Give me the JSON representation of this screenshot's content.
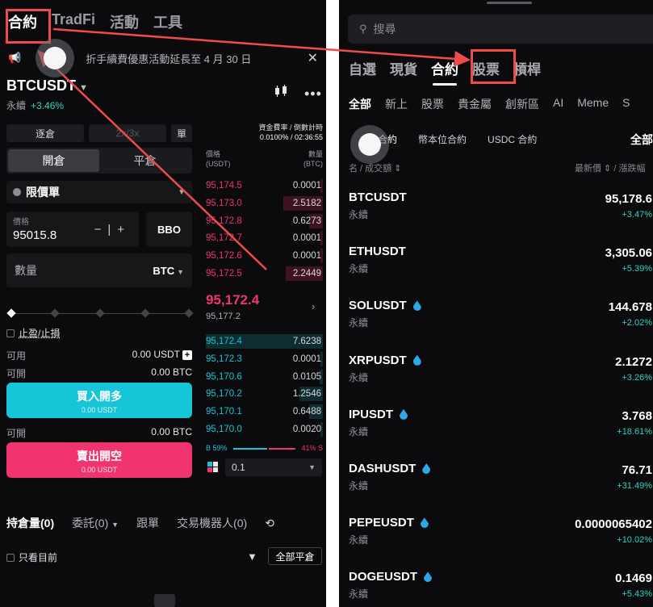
{
  "left": {
    "top_tabs": [
      "合約",
      "TradFi",
      "活動",
      "工具"
    ],
    "notice_text": "折手續費優惠活動延長至 4 月 30 日",
    "pair": {
      "symbol": "BTCUSDT",
      "type": "永續",
      "change": "+3.46%"
    },
    "margin_modes": [
      "逐倉",
      "2x/3x",
      "單"
    ],
    "open_close": [
      "開倉",
      "平倉"
    ],
    "order_type": "限價單",
    "price": {
      "label": "價格",
      "value": "95015.8",
      "minus": "−",
      "plus": "+"
    },
    "bbo_label": "BBO",
    "quantity": {
      "placeholder": "數量",
      "unit": "BTC"
    },
    "tpsl_label": "止盈/止損",
    "available": {
      "label": "可用",
      "value": "0.00 USDT"
    },
    "can_open_long": {
      "label": "可開",
      "value": "0.00 BTC"
    },
    "buy": {
      "label": "買入開多",
      "sub": "0.00 USDT"
    },
    "can_open_short": {
      "label": "可開",
      "value": "0.00 BTC"
    },
    "sell": {
      "label": "賣出開空",
      "sub": "0.00 USDT"
    },
    "funding": {
      "title": "資金費率 / 倒數計時",
      "value": "0.0100% / 02:36:55"
    },
    "orderbook_cols": {
      "price": "價格\n(USDT)",
      "amount": "數量\n(BTC)"
    },
    "asks": [
      {
        "price": "95,174.5",
        "amount": "0.0001",
        "depth": 0.02
      },
      {
        "price": "95,173.0",
        "amount": "2.5182",
        "depth": 0.34
      },
      {
        "price": "95,172.8",
        "amount": "0.6273",
        "depth": 0.12
      },
      {
        "price": "95,172.7",
        "amount": "0.0001",
        "depth": 0.02
      },
      {
        "price": "95,172.6",
        "amount": "0.0001",
        "depth": 0.02
      },
      {
        "price": "95,172.5",
        "amount": "2.2449",
        "depth": 0.32
      }
    ],
    "last_price": "95,172.4",
    "mark_price": "95,177.2",
    "bids": [
      {
        "price": "95,172.4",
        "amount": "7.6238",
        "depth": 1.0
      },
      {
        "price": "95,172.3",
        "amount": "0.0001",
        "depth": 0.02
      },
      {
        "price": "95,170.6",
        "amount": "0.0105",
        "depth": 0.03
      },
      {
        "price": "95,170.2",
        "amount": "1.2546",
        "depth": 0.2
      },
      {
        "price": "95,170.1",
        "amount": "0.6488",
        "depth": 0.12
      },
      {
        "price": "95,170.0",
        "amount": "0.0020",
        "depth": 0.02
      }
    ],
    "ratio": {
      "buy": "B 59%",
      "sell": "41% S"
    },
    "depth_value": "0.1",
    "bottom_tabs": [
      "持倉量(0)",
      "委託(0)",
      "跟單",
      "交易機器人(0)"
    ],
    "only_current": "只看目前",
    "close_all": "全部平倉"
  },
  "right": {
    "search_placeholder": "搜尋",
    "tabs": [
      "自選",
      "現貨",
      "合約",
      "股票",
      "槓桿"
    ],
    "categories": [
      "全部",
      "新上",
      "股票",
      "貴金屬",
      "創新區",
      "AI",
      "Meme",
      "S"
    ],
    "sub_categories": [
      "合約",
      "幣本位合約",
      "USDC 合約"
    ],
    "all_label": "全部",
    "list_head_left": "名 / 成交額 ⇕",
    "list_head_right": "最新價 ⇕ / 漲跌幅",
    "markets": [
      {
        "symbol": "BTCUSDT",
        "type": "永續",
        "price": "95,178.6",
        "change": "+3.47%",
        "drop": false
      },
      {
        "symbol": "ETHUSDT",
        "type": "永續",
        "price": "3,305.06",
        "change": "+5.39%",
        "drop": false
      },
      {
        "symbol": "SOLUSDT",
        "type": "永續",
        "price": "144.678",
        "change": "+2.02%",
        "drop": true
      },
      {
        "symbol": "XRPUSDT",
        "type": "永續",
        "price": "2.1272",
        "change": "+3.26%",
        "drop": true
      },
      {
        "symbol": "IPUSDT",
        "type": "永續",
        "price": "3.768",
        "change": "+18.61%",
        "drop": true
      },
      {
        "symbol": "DASHUSDT",
        "type": "永續",
        "price": "76.71",
        "change": "+31.49%",
        "drop": true
      },
      {
        "symbol": "PEPEUSDT",
        "type": "永續",
        "price": "0.0000065402",
        "change": "+10.02%",
        "drop": true
      },
      {
        "symbol": "DOGEUSDT",
        "type": "永續",
        "price": "0.1469",
        "change": "+5.43%",
        "drop": true
      }
    ]
  },
  "colors": {
    "accent_buy": "#16c6d8",
    "accent_sell": "#f0346f",
    "annotation": "#f04b4b",
    "background": "#0b0b0d"
  }
}
